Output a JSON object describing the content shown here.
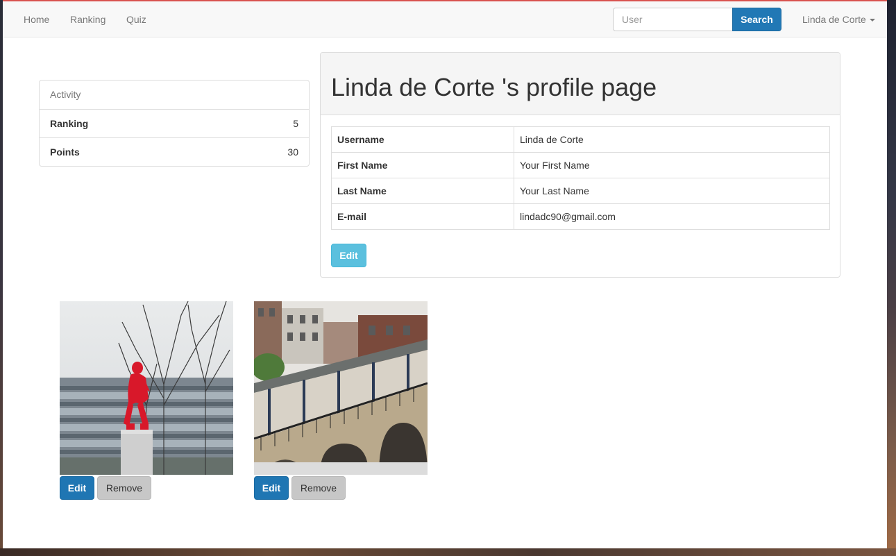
{
  "navbar": {
    "links": [
      "Home",
      "Ranking",
      "Quiz"
    ],
    "search_placeholder": "User",
    "search_button": "Search",
    "user_menu": "Linda de Corte"
  },
  "activity": {
    "heading": "Activity",
    "rows": [
      {
        "label": "Ranking",
        "value": "5"
      },
      {
        "label": "Points",
        "value": "30"
      }
    ]
  },
  "profile": {
    "title": "Linda de Corte 's profile page",
    "fields": [
      {
        "label": "Username",
        "value": "Linda de Corte"
      },
      {
        "label": "First Name",
        "value": "Your First Name"
      },
      {
        "label": "Last Name",
        "value": "Your Last Name"
      },
      {
        "label": "E-mail",
        "value": "lindadc90@gmail.com"
      }
    ],
    "edit_button": "Edit"
  },
  "photos": [
    {
      "subject": "red-statue-photo",
      "edit_label": "Edit",
      "remove_label": "Remove"
    },
    {
      "subject": "staircase-building-photo",
      "edit_label": "Edit",
      "remove_label": "Remove"
    }
  ],
  "colors": {
    "primary": "#1f76b3",
    "info": "#5bc0de",
    "accent_border": "#d9534f"
  }
}
